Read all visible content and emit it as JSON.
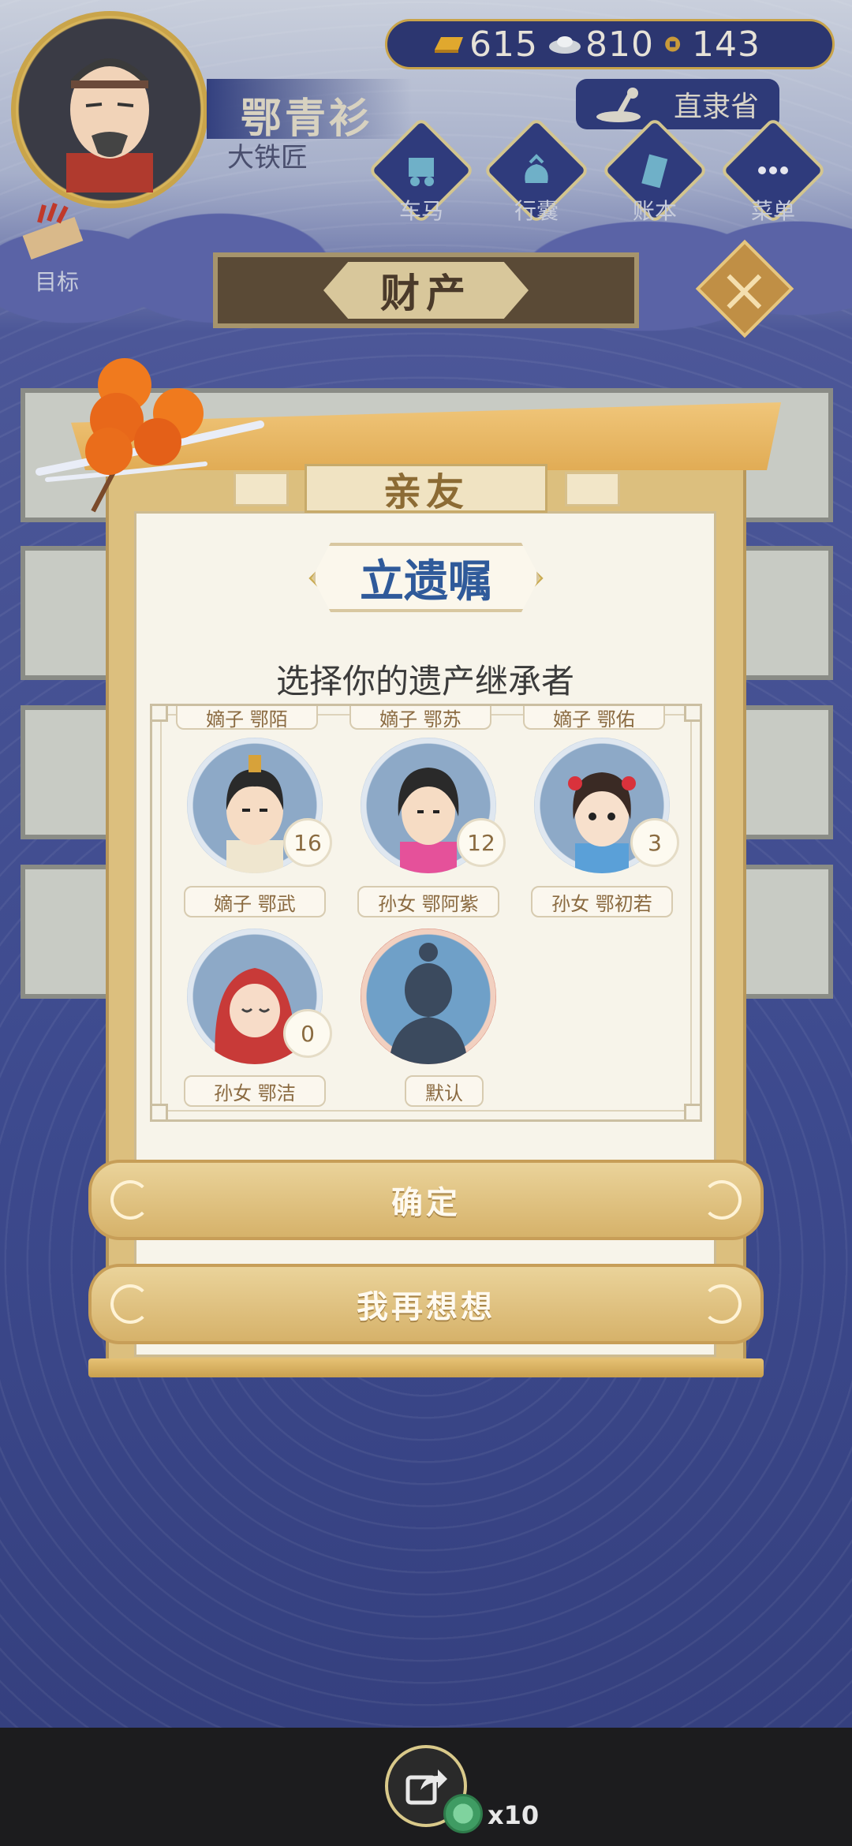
{
  "player": {
    "name": "鄂青衫",
    "title": "大铁匠"
  },
  "currency": {
    "gold": "615",
    "silver": "810",
    "coins": "143"
  },
  "region": "直隶省",
  "hud_buttons": [
    {
      "label": "车马",
      "icon": "carriage-icon"
    },
    {
      "label": "行囊",
      "icon": "bag-icon"
    },
    {
      "label": "账本",
      "icon": "ledger-icon"
    },
    {
      "label": "菜单",
      "icon": "menu-dots-icon"
    }
  ],
  "goal_label": "目标",
  "page_banner": "财产",
  "dialog": {
    "tab": "亲友",
    "title": "立遗嘱",
    "instruction": "选择你的遗产继承者",
    "top_row_labels": [
      "嫡子 鄂陌",
      "嫡子 鄂苏",
      "嫡子 鄂佑"
    ],
    "heirs": [
      {
        "label": "嫡子 鄂武",
        "age": "16"
      },
      {
        "label": "孙女 鄂阿紫",
        "age": "12"
      },
      {
        "label": "孙女 鄂初若",
        "age": "3"
      },
      {
        "label": "孙女 鄂洁",
        "age": "0"
      },
      {
        "label": "默认",
        "age": ""
      }
    ],
    "confirm": "确定",
    "reconsider": "我再想想"
  },
  "share": {
    "count": "x10"
  },
  "colors": {
    "accent_gold": "#d6b26a",
    "title_blue": "#2f5a9a",
    "bg_navy": "#3d4a8e"
  }
}
